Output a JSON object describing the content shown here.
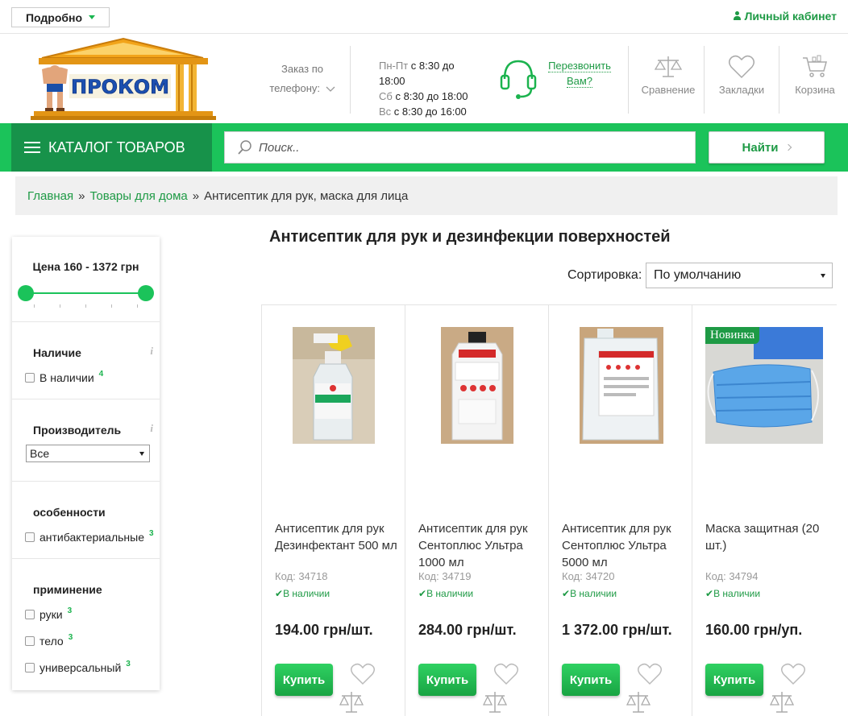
{
  "topbar": {
    "details_label": "Подробно",
    "account_label": "Личный кабинет"
  },
  "header": {
    "logo_text": "ПРОКОМ",
    "phone_order_line1": "Заказ по",
    "phone_order_line2": "телефону:",
    "hours": [
      {
        "label": "Пн-Пт",
        "value": "с 8:30 до"
      },
      {
        "label": "",
        "value": "18:00"
      },
      {
        "label": "Сб",
        "value": "с 8:30 до 18:00"
      },
      {
        "label": "Вс",
        "value": "с 8:30 до 16:00"
      }
    ],
    "callback_line1": "Перезвонить",
    "callback_line2": "Вам?",
    "compare_label": "Сравнение",
    "bookmarks_label": "Закладки",
    "cart_label": "Корзина"
  },
  "nav": {
    "catalog_label": "КАТАЛОГ ТОВАРОВ",
    "search_placeholder": "Поиск..",
    "find_label": "Найти"
  },
  "breadcrumb": {
    "home": "Главная",
    "category": "Товары для дома",
    "current": "Антисептик для рук, маска для лица",
    "separator": "»"
  },
  "filters": {
    "price_title": "Цена 160 - 1372 грн",
    "price_min": 160,
    "price_max": 1372,
    "availability_title": "Наличие",
    "availability_option": "В наличии",
    "availability_count": "4",
    "manufacturer_title": "Производитель",
    "manufacturer_value": "Все",
    "features_title": "особенности",
    "features_option": "антибактериальные",
    "features_count": "3",
    "usage_title": "приминение",
    "usage_options": [
      {
        "label": "руки",
        "count": "3"
      },
      {
        "label": "тело",
        "count": "3"
      },
      {
        "label": "универсальный",
        "count": "3"
      }
    ],
    "info_glyph": "i"
  },
  "main": {
    "title": "Антисептик для рук и дезинфекции поверхностей",
    "sort_label": "Сортировка:",
    "sort_value": "По умолчанию"
  },
  "products": [
    {
      "name": "Антисептик для рук Дезинфектант 500 мл",
      "code": "Код: 34718",
      "stock": "В наличии",
      "price": "194.00 грн/шт.",
      "buy": "Купить",
      "badge": ""
    },
    {
      "name": "Антисептик для рук Сентоплюс Ультра 1000 мл",
      "code": "Код: 34719",
      "stock": "В наличии",
      "price": "284.00 грн/шт.",
      "buy": "Купить",
      "badge": ""
    },
    {
      "name": "Антисептик для рук Сентоплюс Ультра 5000 мл",
      "code": "Код: 34720",
      "stock": "В наличии",
      "price": "1 372.00 грн/шт.",
      "buy": "Купить",
      "badge": ""
    },
    {
      "name": "Маска защитная (20 шт.)",
      "code": "Код: 34794",
      "stock": "В наличии",
      "price": "160.00 грн/уп.",
      "buy": "Купить",
      "badge": "Новинка"
    }
  ],
  "colors": {
    "accent": "#1bc35a",
    "accent_dark": "#17924a",
    "link": "#1e9a45"
  }
}
